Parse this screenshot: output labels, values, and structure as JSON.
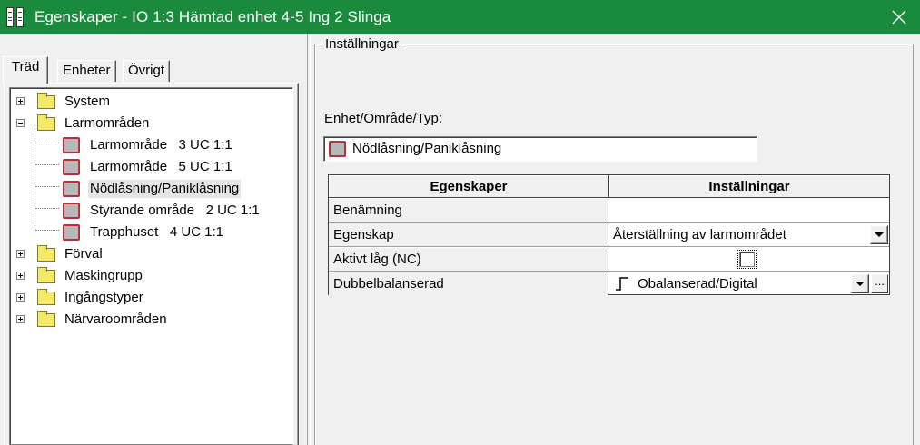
{
  "window": {
    "title": "Egenskaper - IO 1:3 Hämtad enhet 4-5 Ing 2 Slinga",
    "close_icon": "close-icon",
    "title_bar_color": "#1a8a3c"
  },
  "tabs": [
    {
      "label": "Träd",
      "active": true
    },
    {
      "label": "Enheter",
      "active": false
    },
    {
      "label": "Övrigt",
      "active": false
    }
  ],
  "tree": {
    "items": [
      {
        "label": "System",
        "type": "folder",
        "expanded": false
      },
      {
        "label": "Larmområden",
        "type": "folder",
        "expanded": true
      },
      {
        "label": "Larmområde   3 UC 1:1",
        "type": "area"
      },
      {
        "label": "Larmområde   5 UC 1:1",
        "type": "area"
      },
      {
        "label": "Nödlåsning/Paniklåsning",
        "type": "area",
        "selected": true
      },
      {
        "label": "Styrande område   2 UC 1:1",
        "type": "area"
      },
      {
        "label": "Trapphuset   4 UC 1:1",
        "type": "area"
      },
      {
        "label": "Förval",
        "type": "folder",
        "expanded": false
      },
      {
        "label": "Maskingrupp",
        "type": "folder",
        "expanded": false
      },
      {
        "label": "Ingångstyper",
        "type": "folder",
        "expanded": false
      },
      {
        "label": "Närvaroområden",
        "type": "folder",
        "expanded": false
      }
    ]
  },
  "settings": {
    "group_title": "Inställningar",
    "unit_label": "Enhet/Område/Typ:",
    "unit_value": "Nödlåsning/Paniklåsning",
    "grid": {
      "headers": [
        "Egenskaper",
        "Inställningar"
      ],
      "rows": [
        {
          "name": "Benämning",
          "value": ""
        },
        {
          "name": "Egenskap",
          "value": "Återställning av larmområdet"
        },
        {
          "name": "Aktivt låg (NC)",
          "value": "",
          "checked": false
        },
        {
          "name": "Dubbelbalanserad",
          "value": "Obalanserad/Digital"
        }
      ],
      "ellipsis_label": "..."
    }
  }
}
